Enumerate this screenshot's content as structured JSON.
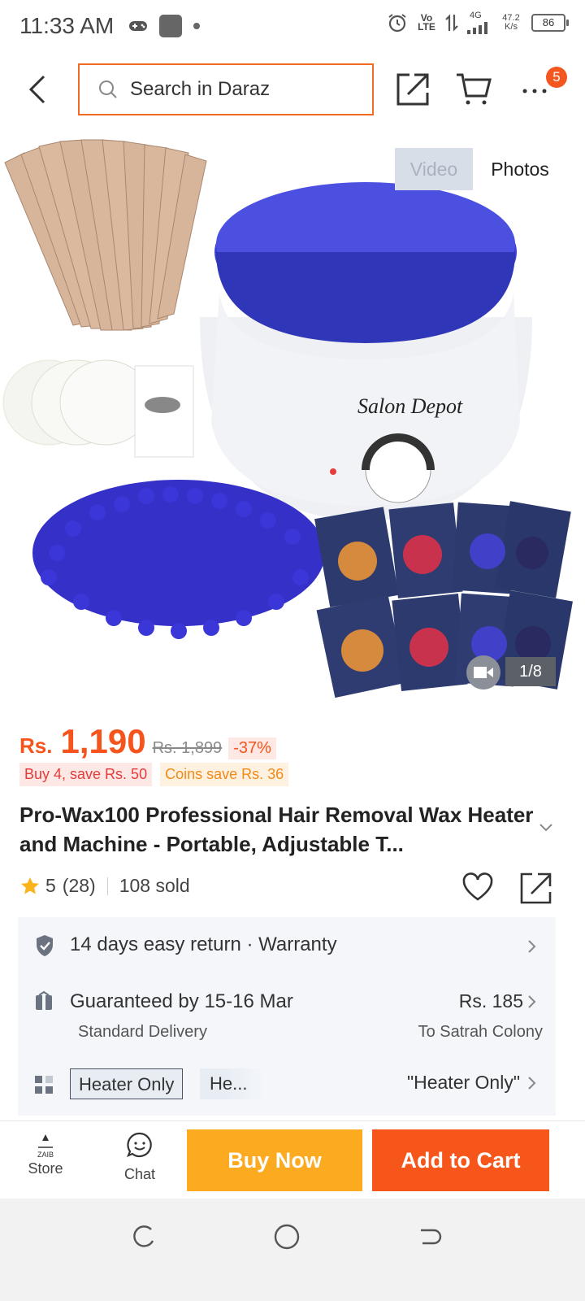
{
  "status_bar": {
    "time": "11:33 AM",
    "network_volte": "Vo LTE",
    "network_4g": "4G",
    "speed_value": "47.2",
    "speed_unit": "K/s",
    "battery": "86"
  },
  "header": {
    "search_placeholder": "Search in Daraz",
    "cart_badge": "5"
  },
  "gallery": {
    "tab_video": "Video",
    "tab_photos": "Photos",
    "counter": "1/8",
    "product_image_brand": "Salon Depot"
  },
  "product": {
    "currency": "Rs.",
    "price": "1,190",
    "original_price": "Rs. 1,899",
    "discount": "-37%",
    "promo_bundle": "Buy 4, save Rs. 50",
    "promo_coins": "Coins save Rs. 36",
    "title": "Pro-Wax100 Professional Hair Removal Wax Heater and Machine - Portable, Adjustable T...",
    "rating": "5",
    "rating_count": "(28)",
    "sold": "108 sold"
  },
  "info": {
    "return_text": "14 days easy return  ·  Warranty",
    "delivery_title": "Guaranteed by 15-16 Mar",
    "delivery_type": "Standard Delivery",
    "delivery_fee": "Rs. 185",
    "delivery_location": "To Satrah Colony",
    "variant_selected": "Heater Only",
    "variant_other": "He...",
    "variant_summary": "\"Heater Only\""
  },
  "bottom_bar": {
    "store_label": "Store",
    "store_logo_text": "ZAIB",
    "chat_label": "Chat",
    "buy_now": "Buy Now",
    "add_to_cart": "Add to Cart"
  },
  "colors": {
    "accent_orange": "#f5541d",
    "buy_now": "#fcaa20",
    "add_to_cart": "#f6561a",
    "search_border": "#f26a23"
  },
  "icons": [
    "back-icon",
    "search-icon",
    "share-icon",
    "cart-icon",
    "more-icon",
    "video-icon",
    "star-icon",
    "heart-icon",
    "shield-icon",
    "gift-icon",
    "grid-icon",
    "chevron-right-icon",
    "chevron-down-icon",
    "chat-icon"
  ]
}
